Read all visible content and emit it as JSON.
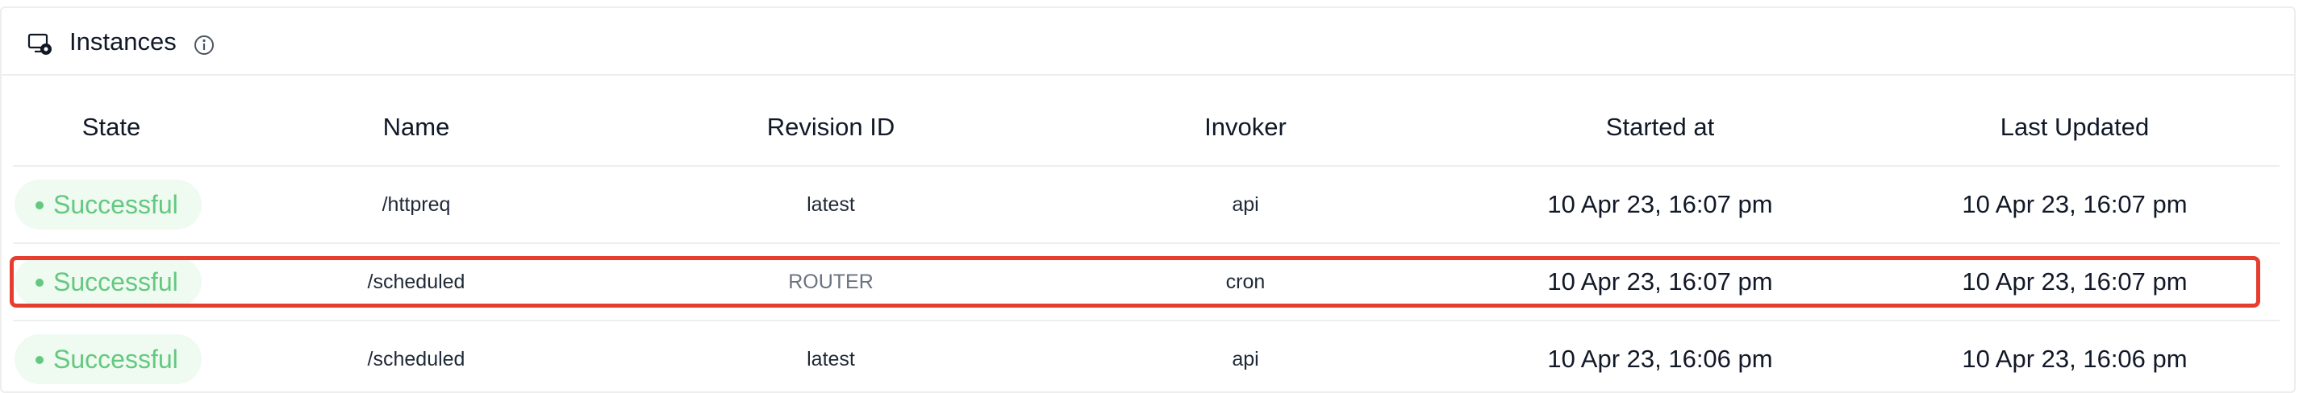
{
  "header": {
    "title": "Instances",
    "icon": "monitor-gear-icon",
    "info_icon": "info-icon"
  },
  "table": {
    "columns": [
      "State",
      "Name",
      "Revision ID",
      "Invoker",
      "Started at",
      "Last Updated"
    ],
    "rows": [
      {
        "state": "Successful",
        "name": "/httpreq",
        "revision": "latest",
        "invoker": "api",
        "started": "10 Apr 23, 16:07 pm",
        "updated": "10 Apr 23, 16:07 pm"
      },
      {
        "state": "Successful",
        "name": "/scheduled",
        "revision": "ROUTER",
        "invoker": "cron",
        "started": "10 Apr 23, 16:07 pm",
        "updated": "10 Apr 23, 16:07 pm"
      },
      {
        "state": "Successful",
        "name": "/scheduled",
        "revision": "latest",
        "invoker": "api",
        "started": "10 Apr 23, 16:06 pm",
        "updated": "10 Apr 23, 16:06 pm"
      }
    ]
  },
  "colors": {
    "success_text": "#63c97f",
    "success_bg": "#effaf1",
    "highlight_border": "#e53e2f"
  }
}
